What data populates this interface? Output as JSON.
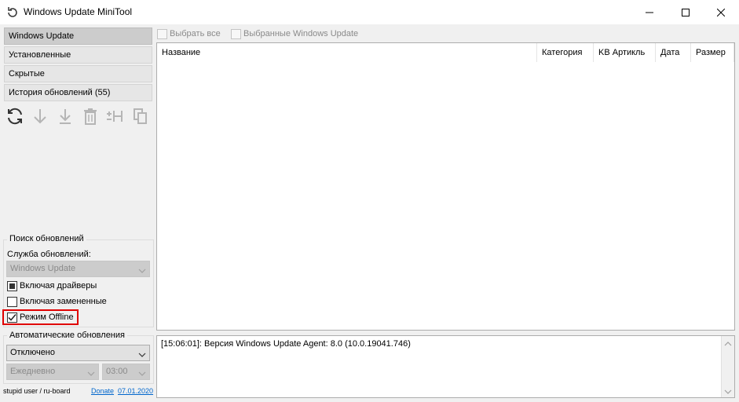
{
  "window": {
    "title": "Windows Update MiniTool"
  },
  "sidebar": {
    "nav": [
      {
        "label": "Windows Update",
        "active": true
      },
      {
        "label": "Установленные",
        "active": false
      },
      {
        "label": "Скрытые",
        "active": false
      },
      {
        "label": "История обновлений (55)",
        "active": false
      }
    ],
    "toolbar_icons": [
      "refresh-icon",
      "download-icon",
      "install-icon",
      "delete-icon",
      "hide-icon",
      "copy-icon"
    ]
  },
  "search_group": {
    "title": "Поиск обновлений",
    "service_label": "Служба обновлений:",
    "service_value": "Windows Update",
    "include_drivers": "Включая драйверы",
    "include_superseded": "Включая замененные",
    "offline_mode": "Режим Offline"
  },
  "auto_group": {
    "title": "Автоматические обновления",
    "mode_value": "Отключено",
    "schedule_value": "Ежедневно",
    "time_value": "03:00"
  },
  "footer": {
    "credits": "stupid user / ru-board",
    "donate": "Donate",
    "date": "07.01.2020"
  },
  "header": {
    "select_all": "Выбрать все",
    "selected": "Выбранные Windows Update"
  },
  "table": {
    "columns": [
      "Название",
      "Категория",
      "KB Артикль",
      "Дата",
      "Размер"
    ]
  },
  "log": {
    "line": "[15:06:01]: Версия Windows Update Agent: 8.0 (10.0.19041.746)"
  }
}
